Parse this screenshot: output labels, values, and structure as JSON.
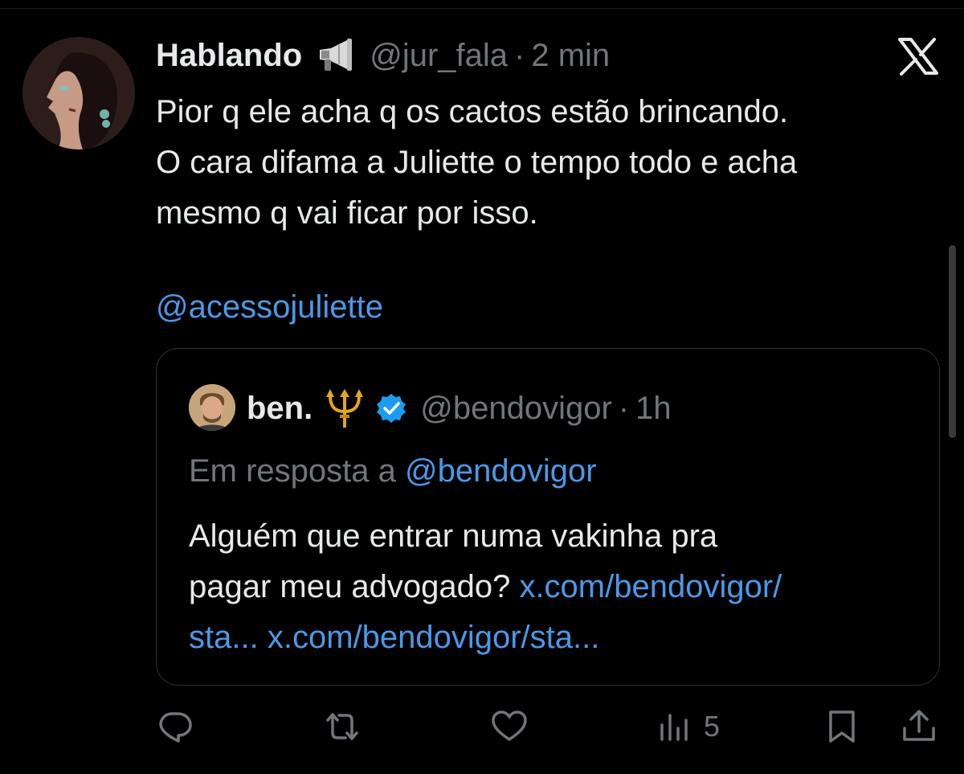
{
  "tweet": {
    "author_name": "Hablando",
    "emoji_icon": "megaphone-icon",
    "handle": "@jur_fala",
    "separator": "·",
    "time": "2 min",
    "text_lines": [
      "Pior q ele acha q os cactos estão brincando.",
      "O cara difama a Juliette o tempo todo e acha",
      "mesmo q vai ficar por isso."
    ],
    "mention": "@acessojuliette"
  },
  "quote": {
    "author_name": "ben.",
    "emoji_icon": "trident-icon",
    "verified_icon": "verified-badge-icon",
    "handle": "@bendovigor",
    "separator": "·",
    "time": "1h",
    "reply_prefix": "Em resposta a",
    "reply_to": "@bendovigor",
    "text_part1": "Alguém que entrar numa vakinha pra",
    "text_part2": "pagar meu advogado?",
    "link1_a": "x.com/bendovigor/",
    "link1_b": "sta...",
    "link2": "x.com/bendovigor/sta..."
  },
  "actions": {
    "reply_icon": "reply-icon",
    "retweet_icon": "retweet-icon",
    "like_icon": "heart-icon",
    "views_icon": "views-icon",
    "views_count": "5",
    "bookmark_icon": "bookmark-icon",
    "share_icon": "share-icon"
  },
  "colors": {
    "background": "#000000",
    "text": "#e7e9ea",
    "muted": "#71767b",
    "link": "#4a99e9",
    "verified": "#1d9bf0"
  }
}
